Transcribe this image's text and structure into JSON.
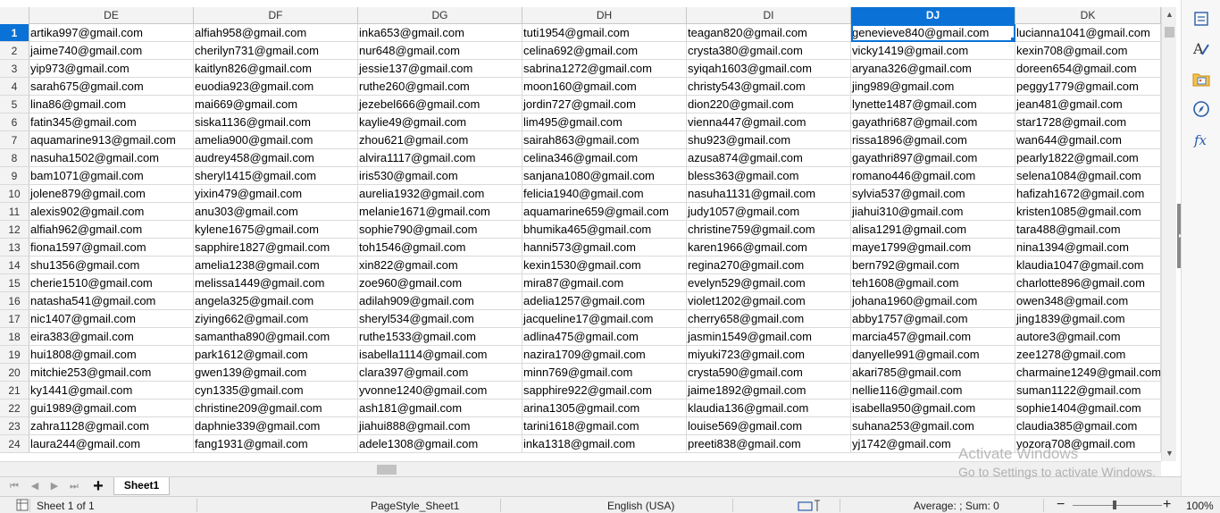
{
  "columns": [
    "DE",
    "DF",
    "DG",
    "DH",
    "DI",
    "DJ",
    "DK"
  ],
  "selected_column": "DJ",
  "rows": [
    {
      "n": "1",
      "cells": [
        "artika997@gmail.com",
        "alfiah958@gmail.com",
        "inka653@gmail.com",
        "tuti1954@gmail.com",
        "teagan820@gmail.com",
        "genevieve840@gmail.com",
        "lucianna1041@gmail.com"
      ]
    },
    {
      "n": "2",
      "cells": [
        "jaime740@gmail.com",
        "cherilyn731@gmail.com",
        "nur648@gmail.com",
        "celina692@gmail.com",
        "crysta380@gmail.com",
        "vicky1419@gmail.com",
        "kexin708@gmail.com"
      ]
    },
    {
      "n": "3",
      "cells": [
        "yip973@gmail.com",
        "kaitlyn826@gmail.com",
        "jessie137@gmail.com",
        "sabrina1272@gmail.com",
        "syiqah1603@gmail.com",
        "aryana326@gmail.com",
        "doreen654@gmail.com"
      ]
    },
    {
      "n": "4",
      "cells": [
        "sarah675@gmail.com",
        "euodia923@gmail.com",
        "ruthe260@gmail.com",
        "moon160@gmail.com",
        "christy543@gmail.com",
        "jing989@gmail.com",
        "peggy1779@gmail.com"
      ]
    },
    {
      "n": "5",
      "cells": [
        "lina86@gmail.com",
        "mai669@gmail.com",
        "jezebel666@gmail.com",
        "jordin727@gmail.com",
        "dion220@gmail.com",
        "lynette1487@gmail.com",
        "jean481@gmail.com"
      ]
    },
    {
      "n": "6",
      "cells": [
        "fatin345@gmail.com",
        "siska1136@gmail.com",
        "kaylie49@gmail.com",
        "lim495@gmail.com",
        "vienna447@gmail.com",
        "gayathri687@gmail.com",
        "star1728@gmail.com"
      ]
    },
    {
      "n": "7",
      "cells": [
        "aquamarine913@gmail.com",
        "amelia900@gmail.com",
        "zhou621@gmail.com",
        "sairah863@gmail.com",
        "shu923@gmail.com",
        "rissa1896@gmail.com",
        "wan644@gmail.com"
      ]
    },
    {
      "n": "8",
      "cells": [
        "nasuha1502@gmail.com",
        "audrey458@gmail.com",
        "alvira1117@gmail.com",
        "celina346@gmail.com",
        "azusa874@gmail.com",
        "gayathri897@gmail.com",
        "pearly1822@gmail.com"
      ]
    },
    {
      "n": "9",
      "cells": [
        "bam1071@gmail.com",
        "sheryl1415@gmail.com",
        "iris530@gmail.com",
        "sanjana1080@gmail.com",
        "bless363@gmail.com",
        "romano446@gmail.com",
        "selena1084@gmail.com"
      ]
    },
    {
      "n": "10",
      "cells": [
        "jolene879@gmail.com",
        "yixin479@gmail.com",
        "aurelia1932@gmail.com",
        "felicia1940@gmail.com",
        "nasuha1131@gmail.com",
        "sylvia537@gmail.com",
        "hafizah1672@gmail.com"
      ]
    },
    {
      "n": "11",
      "cells": [
        "alexis902@gmail.com",
        "anu303@gmail.com",
        "melanie1671@gmail.com",
        "aquamarine659@gmail.com",
        "judy1057@gmail.com",
        "jiahui310@gmail.com",
        "kristen1085@gmail.com"
      ]
    },
    {
      "n": "12",
      "cells": [
        "alfiah962@gmail.com",
        "kylene1675@gmail.com",
        "sophie790@gmail.com",
        "bhumika465@gmail.com",
        "christine759@gmail.com",
        "alisa1291@gmail.com",
        "tara488@gmail.com"
      ]
    },
    {
      "n": "13",
      "cells": [
        "fiona1597@gmail.com",
        "sapphire1827@gmail.com",
        "toh1546@gmail.com",
        "hanni573@gmail.com",
        "karen1966@gmail.com",
        "maye1799@gmail.com",
        "nina1394@gmail.com"
      ]
    },
    {
      "n": "14",
      "cells": [
        "shu1356@gmail.com",
        "amelia1238@gmail.com",
        "xin822@gmail.com",
        "kexin1530@gmail.com",
        "regina270@gmail.com",
        "bern792@gmail.com",
        "klaudia1047@gmail.com"
      ]
    },
    {
      "n": "15",
      "cells": [
        "cherie1510@gmail.com",
        "melissa1449@gmail.com",
        "zoe960@gmail.com",
        "mira87@gmail.com",
        "evelyn529@gmail.com",
        "teh1608@gmail.com",
        "charlotte896@gmail.com"
      ]
    },
    {
      "n": "16",
      "cells": [
        "natasha541@gmail.com",
        "angela325@gmail.com",
        "adilah909@gmail.com",
        "adelia1257@gmail.com",
        "violet1202@gmail.com",
        "johana1960@gmail.com",
        "owen348@gmail.com"
      ]
    },
    {
      "n": "17",
      "cells": [
        "nic1407@gmail.com",
        "ziying662@gmail.com",
        "sheryl534@gmail.com",
        "jacqueline17@gmail.com",
        "cherry658@gmail.com",
        "abby1757@gmail.com",
        "jing1839@gmail.com"
      ]
    },
    {
      "n": "18",
      "cells": [
        "eira383@gmail.com",
        "samantha890@gmail.com",
        "ruthe1533@gmail.com",
        "adlina475@gmail.com",
        "jasmin1549@gmail.com",
        "marcia457@gmail.com",
        "autore3@gmail.com"
      ]
    },
    {
      "n": "19",
      "cells": [
        "hui1808@gmail.com",
        "park1612@gmail.com",
        "isabella1114@gmail.com",
        "nazira1709@gmail.com",
        "miyuki723@gmail.com",
        "danyelle991@gmail.com",
        "zee1278@gmail.com"
      ]
    },
    {
      "n": "20",
      "cells": [
        "mitchie253@gmail.com",
        "gwen139@gmail.com",
        "clara397@gmail.com",
        "minn769@gmail.com",
        "crysta590@gmail.com",
        "akari785@gmail.com",
        "charmaine1249@gmail.com"
      ]
    },
    {
      "n": "21",
      "cells": [
        "ky1441@gmail.com",
        "cyn1335@gmail.com",
        "yvonne1240@gmail.com",
        "sapphire922@gmail.com",
        "jaime1892@gmail.com",
        "nellie116@gmail.com",
        "suman1122@gmail.com"
      ]
    },
    {
      "n": "22",
      "cells": [
        "gui1989@gmail.com",
        "christine209@gmail.com",
        "ash181@gmail.com",
        "arina1305@gmail.com",
        "klaudia136@gmail.com",
        "isabella950@gmail.com",
        "sophie1404@gmail.com"
      ]
    },
    {
      "n": "23",
      "cells": [
        "zahra1128@gmail.com",
        "daphnie339@gmail.com",
        "jiahui888@gmail.com",
        "tarini1618@gmail.com",
        "louise569@gmail.com",
        "suhana253@gmail.com",
        "claudia385@gmail.com"
      ]
    },
    {
      "n": "24",
      "cells": [
        "laura244@gmail.com",
        "fang1931@gmail.com",
        "adele1308@gmail.com",
        "inka1318@gmail.com",
        "preeti838@gmail.com",
        "yj1742@gmail.com",
        "yozora708@gmail.com"
      ]
    }
  ],
  "sheet_tab": "Sheet1",
  "status": {
    "sheet_pos": "Sheet 1 of 1",
    "page_style": "PageStyle_Sheet1",
    "language": "English (USA)",
    "sum_info": "Average: ; Sum: 0",
    "zoom": "100%"
  },
  "watermark": {
    "line1": "Activate Windows",
    "line2": "Go to Settings to activate Windows."
  },
  "sidebar_icons": [
    "properties-icon",
    "styles-icon",
    "gallery-icon",
    "navigator-icon",
    "functions-icon"
  ]
}
